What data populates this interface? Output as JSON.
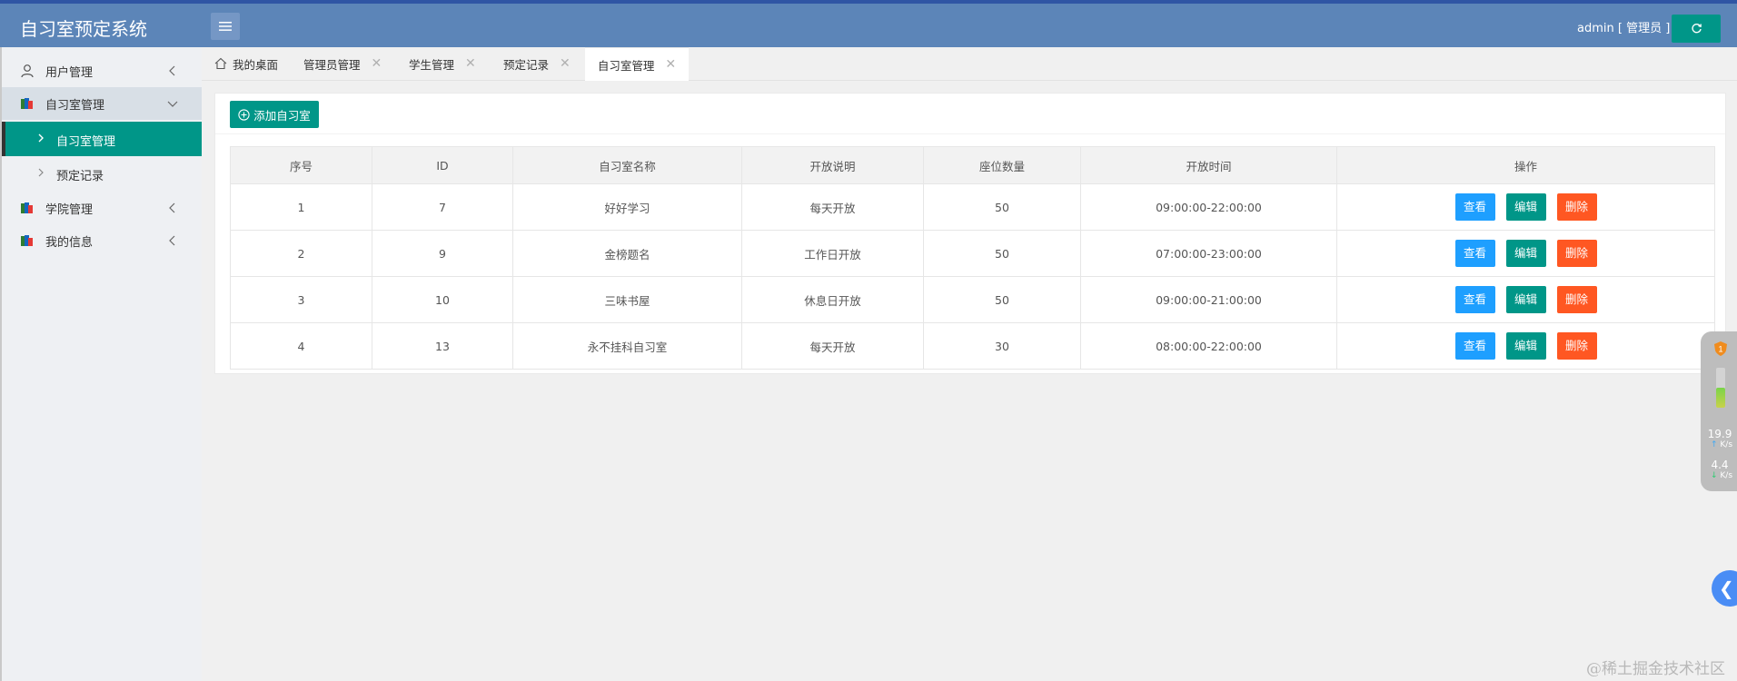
{
  "app": {
    "title": "自习室预定系统"
  },
  "header": {
    "user_label": "admin [ 管理员 ]"
  },
  "sidebar": {
    "items": [
      {
        "label": "用户管理"
      },
      {
        "label": "自习室管理",
        "children": [
          {
            "label": "自习室管理"
          },
          {
            "label": "预定记录"
          }
        ]
      },
      {
        "label": "学院管理"
      },
      {
        "label": "我的信息"
      }
    ]
  },
  "tabs": [
    {
      "label": "我的桌面"
    },
    {
      "label": "管理员管理"
    },
    {
      "label": "学生管理"
    },
    {
      "label": "预定记录"
    },
    {
      "label": "自习室管理"
    }
  ],
  "toolbar": {
    "add_label": "添加自习室"
  },
  "table": {
    "headers": [
      "序号",
      "ID",
      "自习室名称",
      "开放说明",
      "座位数量",
      "开放时间",
      "操作"
    ],
    "rows": [
      [
        "1",
        "7",
        "好好学习",
        "每天开放",
        "50",
        "09:00:00-22:00:00"
      ],
      [
        "2",
        "9",
        "金榜题名",
        "工作日开放",
        "50",
        "07:00:00-23:00:00"
      ],
      [
        "3",
        "10",
        "三味书屋",
        "休息日开放",
        "50",
        "09:00:00-21:00:00"
      ],
      [
        "4",
        "13",
        "永不挂科自习室",
        "每天开放",
        "30",
        "08:00:00-22:00:00"
      ]
    ],
    "actions": {
      "view": "查看",
      "edit": "编辑",
      "delete": "删除"
    }
  },
  "speed_widget": {
    "badge": "1",
    "up_value": "19.9",
    "up_unit": "K/s",
    "down_value": "4.4",
    "down_unit": "K/s"
  },
  "watermark": "@稀土掘金技术社区",
  "colors": {
    "header": "#5c85b8",
    "accent": "#009688",
    "view": "#1e9fff",
    "delete": "#ff5722"
  }
}
